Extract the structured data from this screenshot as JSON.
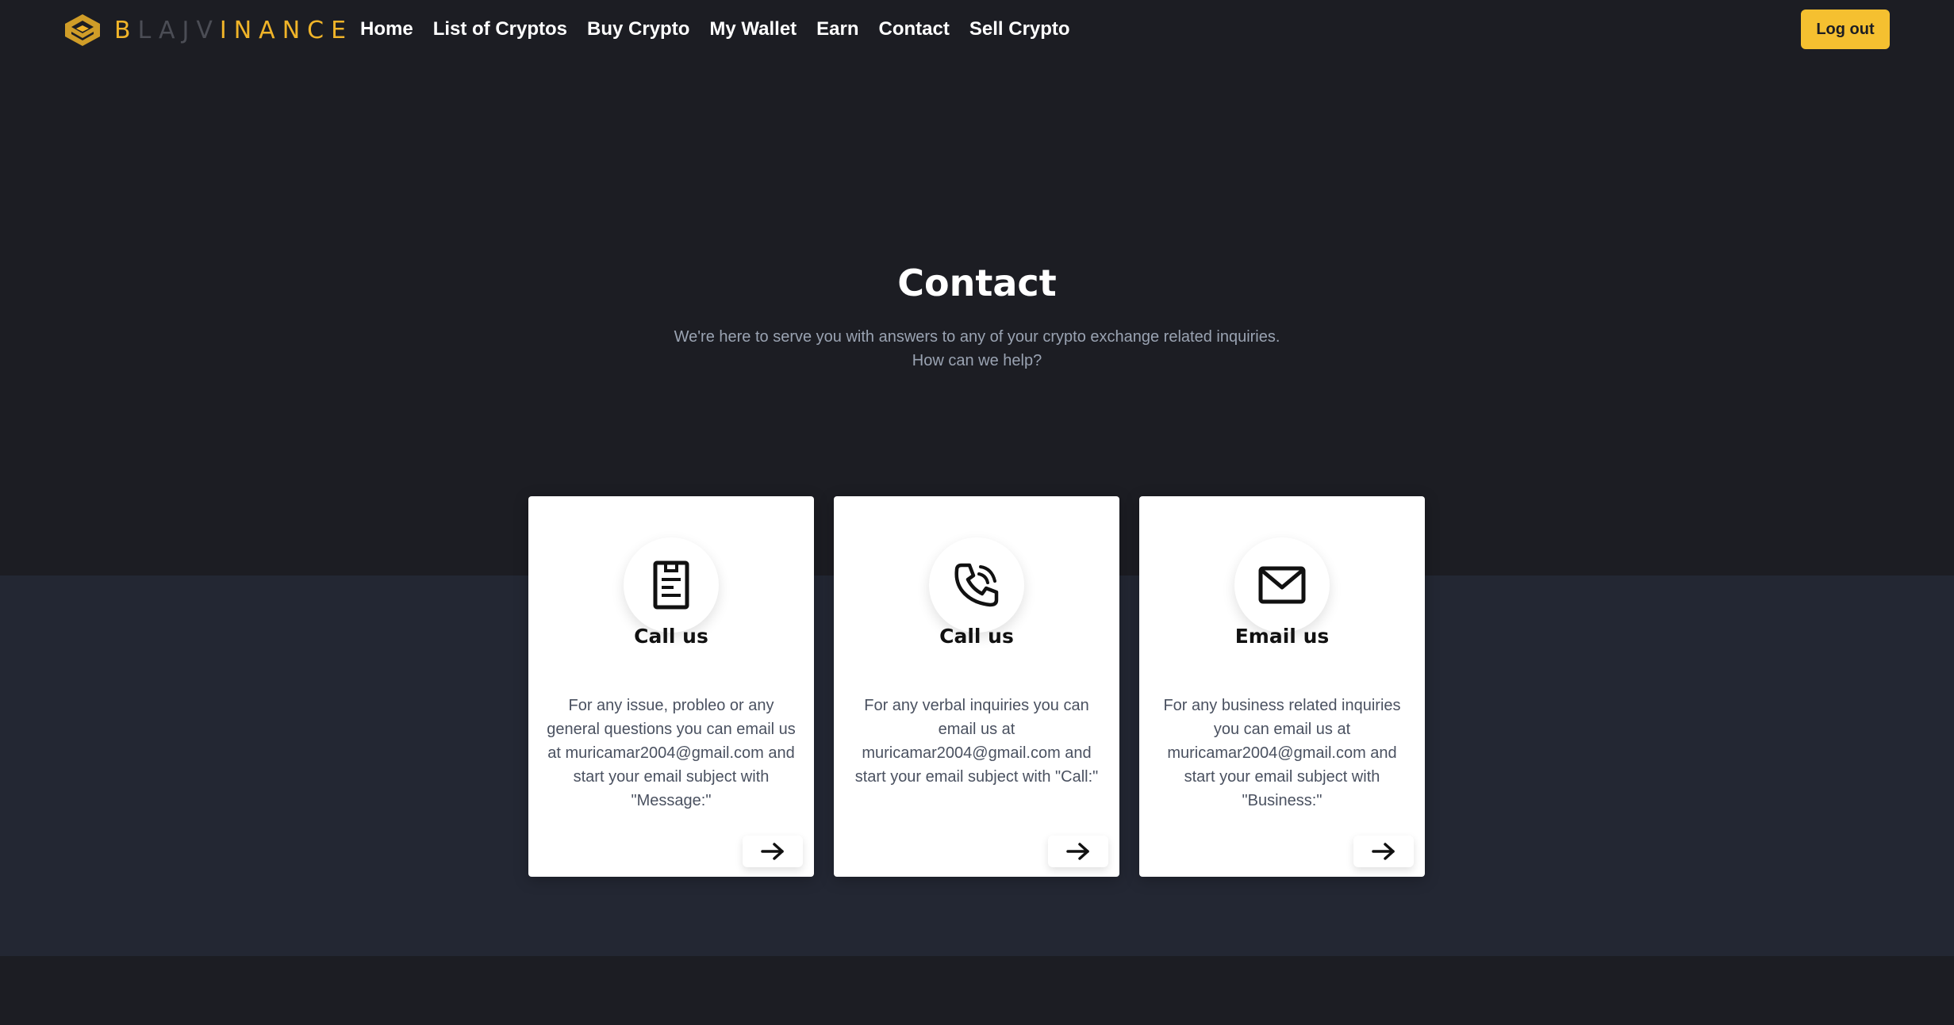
{
  "brand": {
    "logo_parts": [
      {
        "text": "B",
        "color": "yellow"
      },
      {
        "text": "LAJV",
        "color": "gray"
      },
      {
        "text": "INANCE",
        "color": "yellow"
      }
    ],
    "accent": "#f5c030"
  },
  "nav": {
    "items": [
      "Home",
      "List of Cryptos",
      "Buy Crypto",
      "My Wallet",
      "Earn",
      "Contact",
      "Sell Crypto"
    ],
    "logout_label": "Log out"
  },
  "hero": {
    "title": "Contact",
    "subtitle_line1": "We're here to serve you with answers to any of your crypto exchange related inquiries.",
    "subtitle_line2": "How can we help?"
  },
  "cards": [
    {
      "icon": "document-icon",
      "title": "Call us",
      "text": "For any issue, probleo or any general questions you can email us at muricamar2004@gmail.com and start your email subject with \"Message:\""
    },
    {
      "icon": "phone-icon",
      "title": "Call us",
      "text": "For any verbal inquiries you can email us at muricamar2004@gmail.com and start your email subject with \"Call:\""
    },
    {
      "icon": "mail-icon",
      "title": "Email us",
      "text": "For any business related inquiries you can email us at muricamar2004@gmail.com and start your email subject with \"Business:\""
    }
  ]
}
